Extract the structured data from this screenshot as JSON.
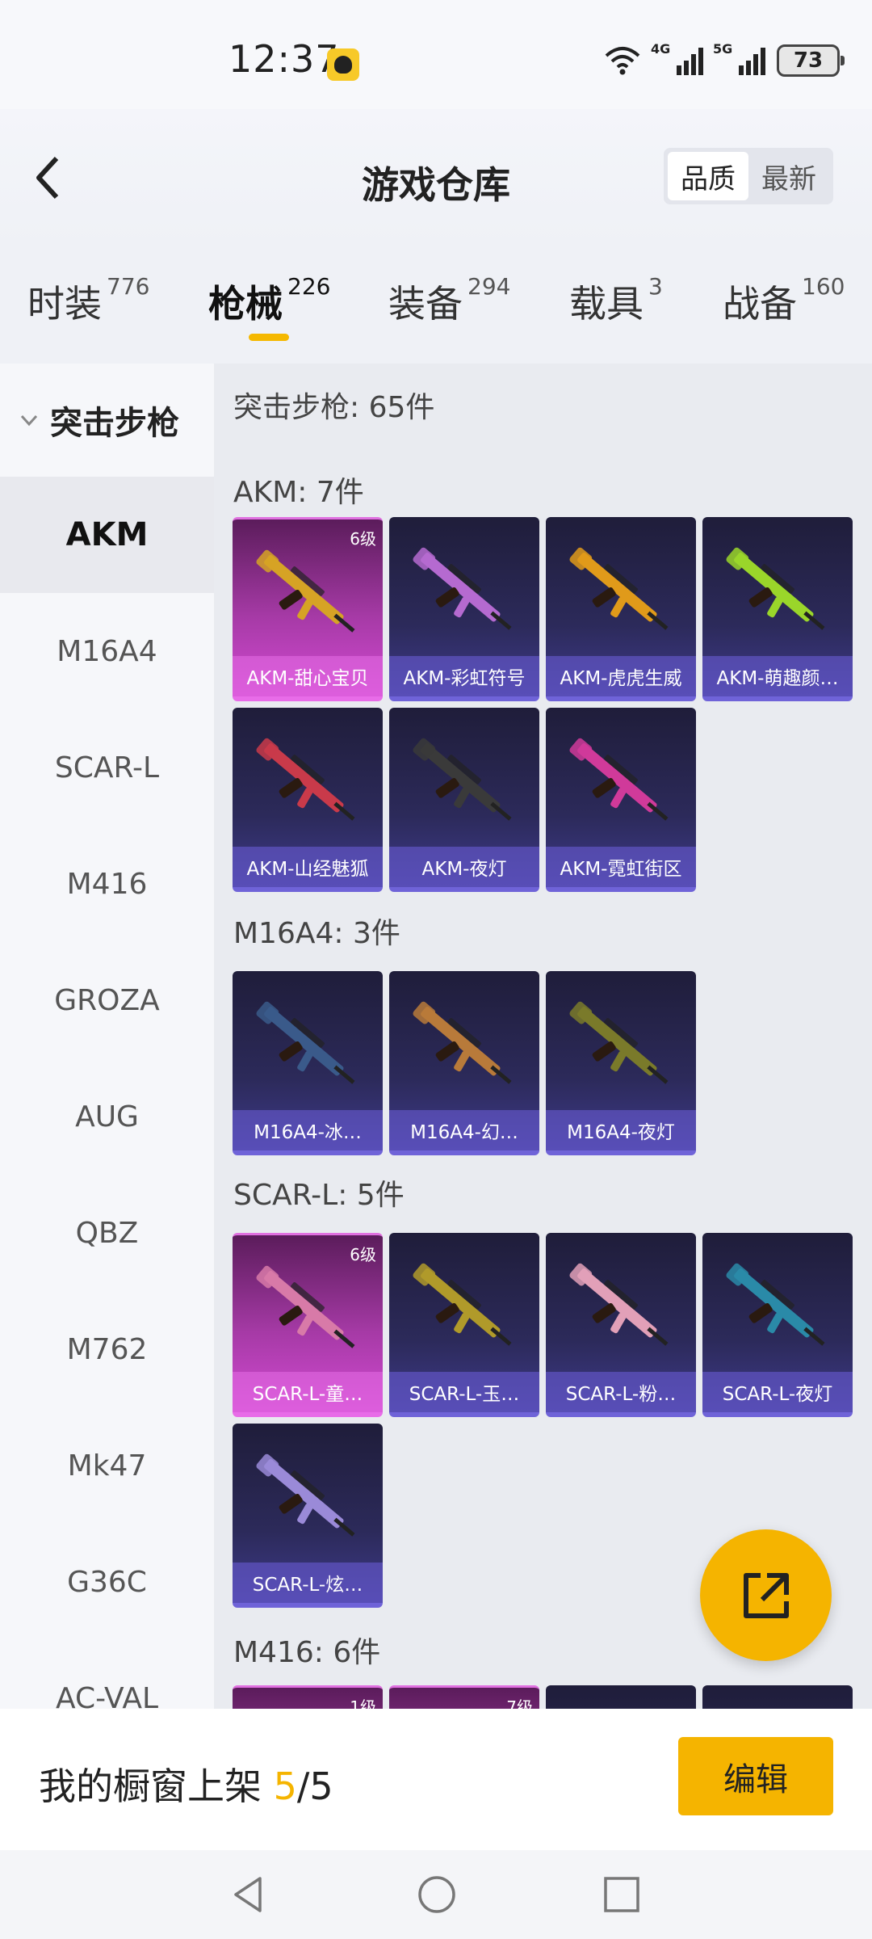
{
  "status": {
    "time": "12:37",
    "signal_4g": "4G",
    "signal_5g": "5G",
    "battery": "73"
  },
  "header": {
    "title": "游戏仓库",
    "sort_options": [
      "品质",
      "最新"
    ],
    "sort_active": "品质"
  },
  "tabs": [
    {
      "label": "时装",
      "count": "776"
    },
    {
      "label": "枪械",
      "count": "226"
    },
    {
      "label": "装备",
      "count": "294"
    },
    {
      "label": "载具",
      "count": "3"
    },
    {
      "label": "战备",
      "count": "160"
    }
  ],
  "sidebar": {
    "group": "突击步枪",
    "items": [
      "AKM",
      "M16A4",
      "SCAR-L",
      "M416",
      "GROZA",
      "AUG",
      "QBZ",
      "M762",
      "Mk47",
      "G36C",
      "AC-VAL"
    ]
  },
  "content": {
    "summary": "突击步枪: 65件",
    "groups": [
      {
        "title": "AKM: 7件",
        "items": [
          {
            "name": "AKM-甜心宝贝",
            "badge": "6级",
            "rarity": "pink"
          },
          {
            "name": "AKM-彩虹符号",
            "badge": "",
            "rarity": "purple"
          },
          {
            "name": "AKM-虎虎生威",
            "badge": "",
            "rarity": "purple"
          },
          {
            "name": "AKM-萌趣颜…",
            "badge": "",
            "rarity": "purple"
          },
          {
            "name": "AKM-山经魅狐",
            "badge": "",
            "rarity": "purple"
          },
          {
            "name": "AKM-夜灯",
            "badge": "",
            "rarity": "purple"
          },
          {
            "name": "AKM-霓虹街区",
            "badge": "",
            "rarity": "purple"
          }
        ]
      },
      {
        "title": "M16A4: 3件",
        "items": [
          {
            "name": "M16A4-冰…",
            "badge": "",
            "rarity": "purple"
          },
          {
            "name": "M16A4-幻…",
            "badge": "",
            "rarity": "purple"
          },
          {
            "name": "M16A4-夜灯",
            "badge": "",
            "rarity": "purple"
          }
        ]
      },
      {
        "title": "SCAR-L: 5件",
        "items": [
          {
            "name": "SCAR-L-童…",
            "badge": "6级",
            "rarity": "pink"
          },
          {
            "name": "SCAR-L-玉…",
            "badge": "",
            "rarity": "purple"
          },
          {
            "name": "SCAR-L-粉…",
            "badge": "",
            "rarity": "purple"
          },
          {
            "name": "SCAR-L-夜灯",
            "badge": "",
            "rarity": "purple"
          },
          {
            "name": "SCAR-L-炫…",
            "badge": "",
            "rarity": "purple"
          }
        ]
      },
      {
        "title": "M416: 6件",
        "items": [
          {
            "name": "",
            "badge": "1级",
            "rarity": "pink"
          },
          {
            "name": "",
            "badge": "7级",
            "rarity": "pink"
          },
          {
            "name": "",
            "badge": "",
            "rarity": "purple"
          },
          {
            "name": "",
            "badge": "",
            "rarity": "purple"
          }
        ]
      }
    ]
  },
  "showcase": {
    "prefix": "我的橱窗上架 ",
    "current": "5",
    "total": "/5",
    "edit_label": "编辑"
  },
  "colors": {
    "accent": "#f5b400",
    "purple_card": "#2c2a5a",
    "pink_card": "#a63aa6"
  }
}
